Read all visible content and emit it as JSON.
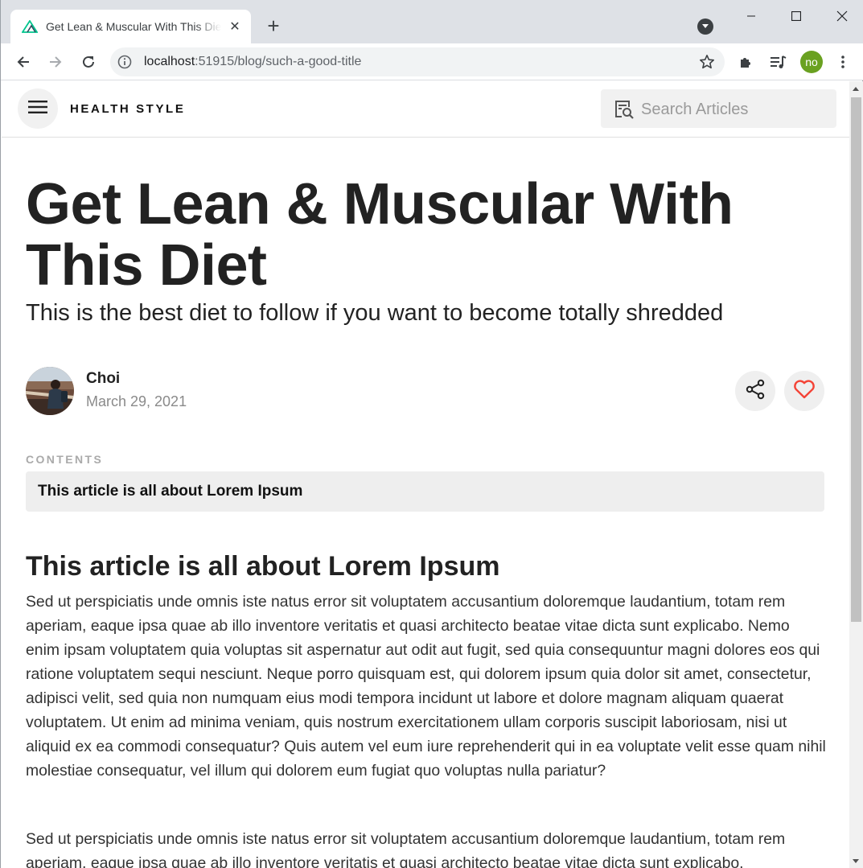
{
  "browser": {
    "tab_title": "Get Lean & Muscular With This Diet",
    "url_host": "localhost",
    "url_port_path": ":51915/blog/such-a-good-title",
    "profile_initials": "no"
  },
  "header": {
    "brand": "HEALTH STYLE",
    "search_placeholder": "Search Articles"
  },
  "article": {
    "title": "Get Lean & Muscular With This Diet",
    "subtitle": "This is the best diet to follow if you want to become totally shredded",
    "author_name": "Choi",
    "date": "March 29, 2021",
    "contents_label": "CONTENTS",
    "contents_items": [
      "This article is all about Lorem Ipsum"
    ],
    "section_heading": "This article is all about Lorem Ipsum",
    "paragraphs": [
      "Sed ut perspiciatis unde omnis iste natus error sit voluptatem accusantium doloremque laudantium, totam rem aperiam, eaque ipsa quae ab illo inventore veritatis et quasi architecto beatae vitae dicta sunt explicabo. Nemo enim ipsam voluptatem quia voluptas sit aspernatur aut odit aut fugit, sed quia consequuntur magni dolores eos qui ratione voluptatem sequi nesciunt. Neque porro quisquam est, qui dolorem ipsum quia dolor sit amet, consectetur, adipisci velit, sed quia non numquam eius modi tempora incidunt ut labore et dolore magnam aliquam quaerat voluptatem. Ut enim ad minima veniam, quis nostrum exercitationem ullam corporis suscipit laboriosam, nisi ut aliquid ex ea commodi consequatur? Quis autem vel eum iure reprehenderit qui in ea voluptate velit esse quam nihil molestiae consequatur, vel illum qui dolorem eum fugiat quo voluptas nulla pariatur?",
      "Sed ut perspiciatis unde omnis iste natus error sit voluptatem accusantium doloremque laudantium, totam rem aperiam, eaque ipsa quae ab illo inventore veritatis et quasi architecto beatae vitae dicta sunt explicabo."
    ]
  },
  "icons": {
    "tab_favicon": "nuxt-logo-icon",
    "share": "share-icon",
    "like": "heart-icon",
    "menu": "hamburger-menu-icon",
    "search": "search-document-icon"
  },
  "colors": {
    "heart": "#f44336",
    "profile": "#6aa121",
    "favicon": "#00c58e"
  }
}
